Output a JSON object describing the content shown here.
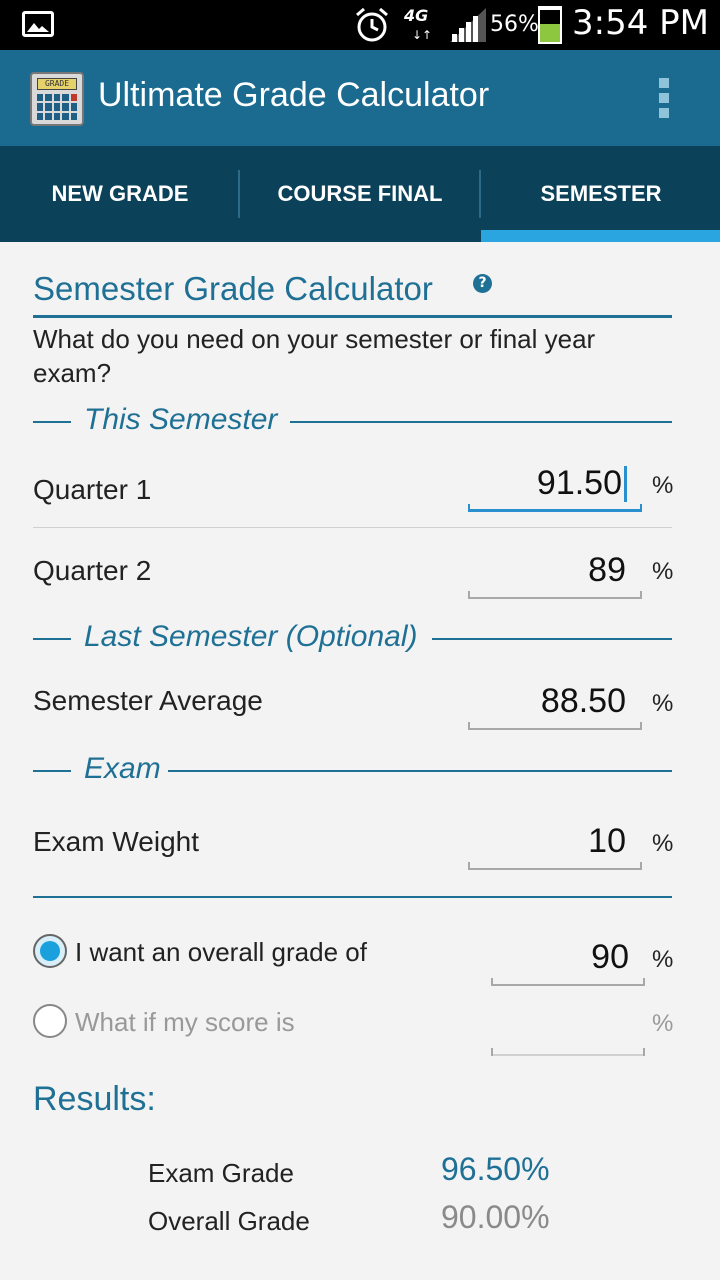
{
  "status_bar": {
    "network": "4G",
    "battery": "56%",
    "battery_level": 0.56,
    "time": "3:54 PM",
    "icons": [
      "image-icon",
      "alarm-icon",
      "signal-icon",
      "battery-icon"
    ]
  },
  "app_bar": {
    "title": "Ultimate Grade Calculator",
    "icon_text": "GRADE",
    "icons": [
      "calculator-app-icon",
      "overflow-menu-icon"
    ]
  },
  "tabs": [
    {
      "label": "NEW GRADE",
      "selected": false
    },
    {
      "label": "COURSE FINAL",
      "selected": false
    },
    {
      "label": "SEMESTER",
      "selected": true
    }
  ],
  "colors": {
    "accent": "#1f7095",
    "app_bar": "#1a6b8f",
    "tab_bar": "#0b4159",
    "tab_indicator": "#2aa5df",
    "background": "#f3f3f3"
  },
  "calculator": {
    "title": "Semester Grade Calculator",
    "help_icon": "?",
    "description": "What do you need on your semester or final year exam?"
  },
  "sections": {
    "this_semester": "This Semester",
    "last_semester": "Last Semester (Optional)",
    "exam": "Exam"
  },
  "fields": {
    "quarter1": {
      "label": "Quarter 1",
      "value": "91.50",
      "unit": "%"
    },
    "quarter2": {
      "label": "Quarter 2",
      "value": "89",
      "unit": "%"
    },
    "semester_average": {
      "label": "Semester Average",
      "value": "88.50",
      "unit": "%"
    },
    "exam_weight": {
      "label": "Exam Weight",
      "value": "10",
      "unit": "%"
    }
  },
  "options": {
    "overall": {
      "label": "I want an overall grade of",
      "value": "90",
      "unit": "%",
      "checked": true
    },
    "what_if": {
      "label": "What if my score is",
      "value": "",
      "unit": "%",
      "checked": false
    }
  },
  "results": {
    "heading": "Results:",
    "exam_grade_label": "Exam Grade",
    "exam_grade_value": "96.50%",
    "overall_grade_label": "Overall Grade",
    "overall_grade_value": "90.00%"
  }
}
